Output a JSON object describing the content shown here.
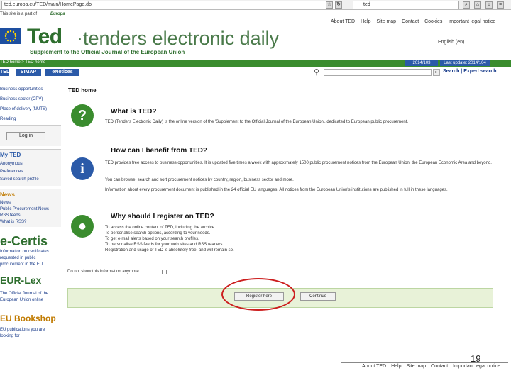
{
  "browser": {
    "url": "ted.europa.eu/TED/main/HomePage.do",
    "search_value": "ted"
  },
  "header": {
    "site_of": "This site is a part of",
    "europa": "Europa",
    "logo_ted": "Ted",
    "logo_rest": "·tenders electronic daily",
    "subtitle": "Supplement to the Official Journal of the European Union",
    "links": [
      "About TED",
      "Help",
      "Site map",
      "Contact",
      "Cookies",
      "Important legal notice"
    ],
    "language": "English (en)"
  },
  "band": {
    "breadcrumb": "TED home > TED home",
    "date1": "2014/103",
    "date2": "Last update: 2014/104"
  },
  "nav": {
    "tabs": [
      "TED",
      "SIMAP",
      "eNotices"
    ],
    "search_label": "Search",
    "expert_label": "Expert search"
  },
  "sidebar": {
    "links_top": [
      "Business opportunities",
      "Business sector (CPV)",
      "Place of delivery (NUTS)",
      "Reading"
    ],
    "login": "Log in",
    "my_ted_title": "My TED",
    "my_ted_links": [
      "Anonymous",
      "Preferences",
      "Saved search profile"
    ],
    "news_title": "News",
    "news_links": [
      "News",
      "Public Procurement News",
      "RSS feeds",
      "What is RSS?"
    ],
    "ecertis": "e-Certis",
    "ecertis_text": [
      "Information on certificates",
      "requested in public",
      "procurement in the EU"
    ],
    "eurlex": "EUR-Lex",
    "eurlex_text": [
      "The Official Journal of the",
      "European Union online"
    ],
    "bookshop": "EU Bookshop",
    "bookshop_text": [
      "EU publications you are",
      "looking for"
    ]
  },
  "main": {
    "home_title": "TED home",
    "section1_title": "What is TED?",
    "section1_text": "TED (Tenders Electronic Daily) is the online version of the 'Supplement to the Official Journal of the European Union', dedicated to European public procurement.",
    "section2_title": "How can I benefit from TED?",
    "section2_p1": "TED provides free access to business opportunities. It is updated five times a week with approximately 1500 public procurement notices from the European Union, the European Economic Area and beyond.",
    "section2_p2": "You can browse, search and sort procurement notices by country, region, business sector and more.",
    "section2_p3": "Information about every procurement document is published in the 24 official EU languages. All notices from the European Union's institutions are published in full in these languages.",
    "section3_title": "Why should I register on TED?",
    "section3_bullets": [
      "To access the online content of TED, including the archive.",
      "To personalise search options, according to your needs.",
      "To get e-mail alerts based on your search profiles.",
      "To personalise RSS feeds for your web sites and RSS readers.",
      "Registration and usage of TED is absolutely free, and will remain so."
    ],
    "dont_show": "Do not show this information anymore.",
    "register": "Register here",
    "continue": "Continue"
  },
  "footer": {
    "page_number": "19",
    "links": [
      "About TED",
      "Help",
      "Site map",
      "Contact",
      "Important legal notice"
    ]
  },
  "colors": {
    "green": "#3a8c2e",
    "blue": "#2b5aa8",
    "annotation_red": "#cc1e1e"
  }
}
